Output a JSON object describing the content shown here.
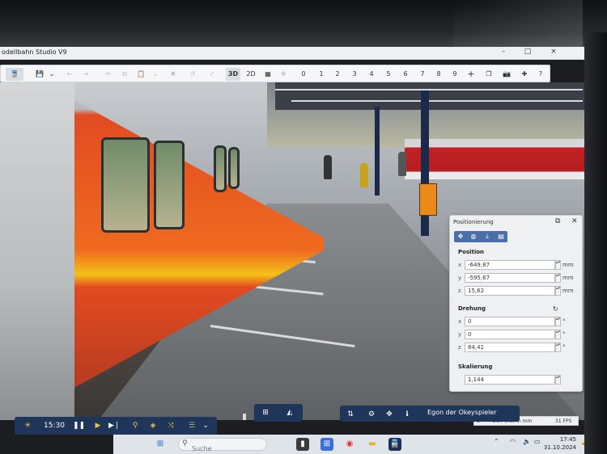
{
  "window": {
    "title": "odellbahn Studio V9",
    "controls": {
      "minimize": "–",
      "maximize": "□",
      "close": "×"
    }
  },
  "toolbar": {
    "view_3d": "3D",
    "view_2d": "2D",
    "numbers": [
      "0",
      "1",
      "2",
      "3",
      "4",
      "5",
      "6",
      "7",
      "8",
      "9"
    ],
    "plus": "+",
    "help": "?"
  },
  "panel": {
    "title": "Positionierung",
    "position": {
      "label": "Position",
      "x": {
        "axis": "x",
        "value": "-649,87",
        "unit": "mm"
      },
      "y": {
        "axis": "y",
        "value": "-595,67",
        "unit": "mm"
      },
      "z": {
        "axis": "z",
        "value": "15,62",
        "unit": "mm"
      }
    },
    "rotation": {
      "label": "Drehung",
      "x": {
        "axis": "x",
        "value": "0",
        "unit": "°"
      },
      "y": {
        "axis": "y",
        "value": "0",
        "unit": "°"
      },
      "z": {
        "axis": "z",
        "value": "84,41",
        "unit": "°"
      }
    },
    "scale": {
      "label": "Skalierung",
      "value": "1,144"
    }
  },
  "status_bar": {
    "scale_text": "1:87 (H0) in mm",
    "fps": "31 FPS"
  },
  "bottom_bar": {
    "time": "15:30",
    "user": "Egon der Okeyspieler"
  },
  "taskbar": {
    "search_placeholder": "Suche",
    "clock_time": "17:45",
    "clock_date": "31.10.2024"
  },
  "colors": {
    "toolbar_bg": "#f5f6f8",
    "bottom_bar_bg": "#20355a",
    "panel_tab_accent": "#4a6fa8",
    "train_orange": "#ef6a1f",
    "train_red": "#c32124"
  }
}
